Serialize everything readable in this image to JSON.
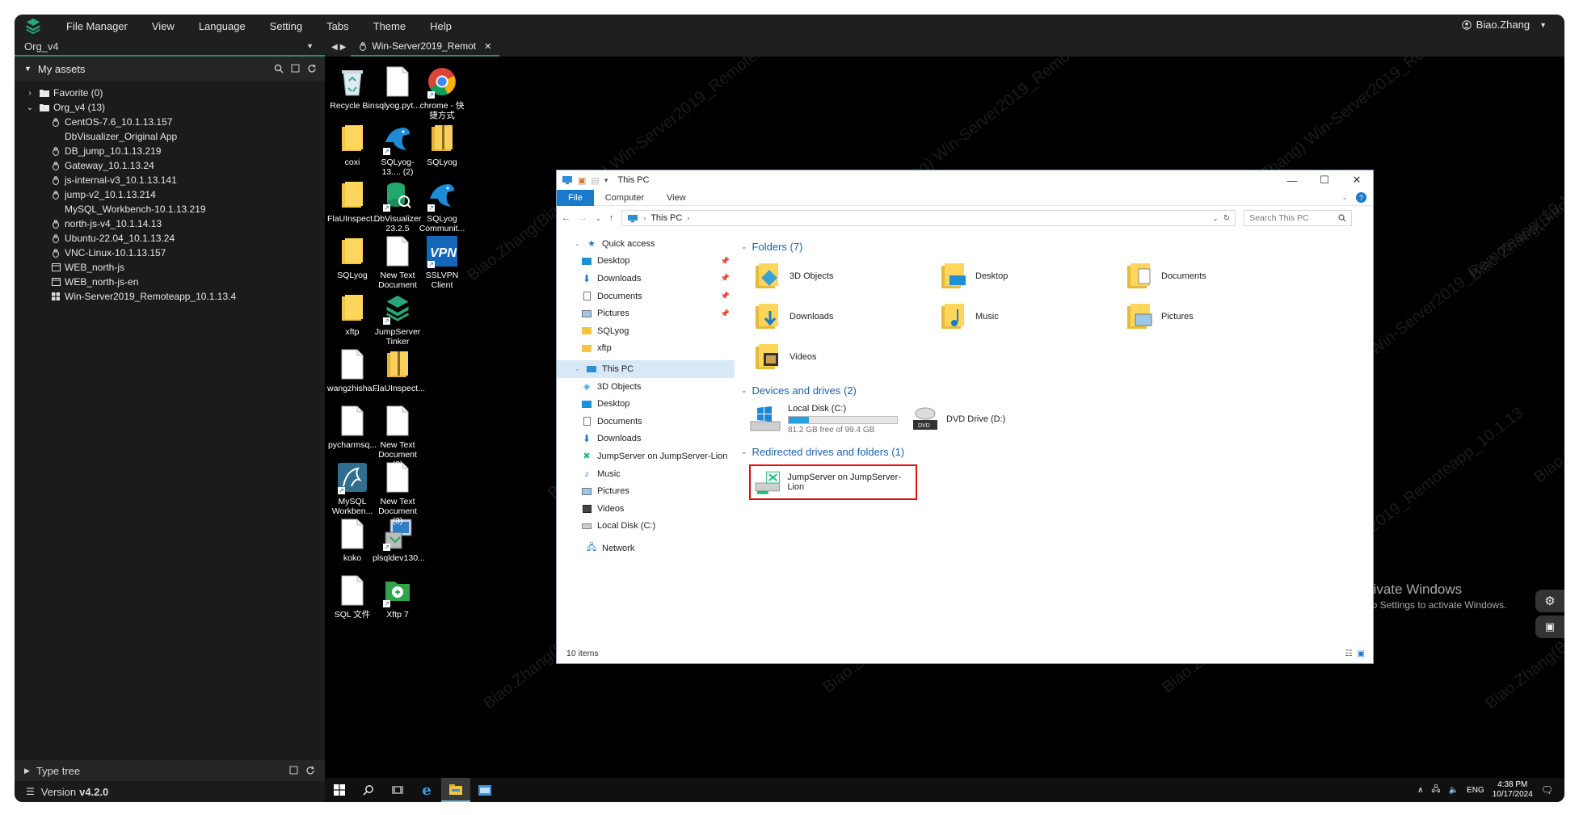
{
  "menubar": {
    "items": [
      "File Manager",
      "View",
      "Language",
      "Setting",
      "Tabs",
      "Theme",
      "Help"
    ],
    "user": "Biao.Zhang"
  },
  "sidebar": {
    "org": "Org_v4",
    "assets_title": "My assets",
    "tree": [
      {
        "label": "Favorite (0)",
        "type": "folder",
        "level": 0,
        "expanded": false
      },
      {
        "label": "Org_v4 (13)",
        "type": "folder",
        "level": 0,
        "expanded": true
      },
      {
        "label": "CentOS-7.6_10.1.13.157",
        "type": "linux",
        "level": 1
      },
      {
        "label": "DbVisualizer_Original App",
        "type": "none",
        "level": 1
      },
      {
        "label": "DB_jump_10.1.13.219",
        "type": "linux",
        "level": 1
      },
      {
        "label": "Gateway_10.1.13.24",
        "type": "linux",
        "level": 1
      },
      {
        "label": "js-internal-v3_10.1.13.141",
        "type": "linux",
        "level": 1
      },
      {
        "label": "jump-v2_10.1.13.214",
        "type": "linux",
        "level": 1
      },
      {
        "label": "MySQL_Workbench-10.1.13.219",
        "type": "none",
        "level": 1
      },
      {
        "label": "north-js-v4_10.1.14.13",
        "type": "linux",
        "level": 1
      },
      {
        "label": "Ubuntu-22.04_10.1.13.24",
        "type": "linux",
        "level": 1
      },
      {
        "label": "VNC-Linux-10.1.13.157",
        "type": "linux",
        "level": 1
      },
      {
        "label": "WEB_north-js",
        "type": "web",
        "level": 1
      },
      {
        "label": "WEB_north-js-en",
        "type": "web",
        "level": 1
      },
      {
        "label": "Win-Server2019_Remoteapp_10.1.13.4",
        "type": "windows",
        "level": 1
      }
    ],
    "type_tree": "Type tree",
    "version_label": "Version",
    "version": "v4.2.0"
  },
  "tab": {
    "label": "Win-Server2019_Remot"
  },
  "desktop": {
    "icons": [
      {
        "label": "Recycle Bin",
        "kind": "recycle-bin"
      },
      {
        "label": "sqlyog.pyt...",
        "kind": "file"
      },
      {
        "label": "chrome - 快捷方式",
        "kind": "chrome"
      },
      {
        "label": "coxi",
        "kind": "folder"
      },
      {
        "label": "SQLyog-13.... (2)",
        "kind": "dolphin"
      },
      {
        "label": "SQLyog",
        "kind": "zip"
      },
      {
        "label": "FlaUInspect...",
        "kind": "folder"
      },
      {
        "label": "DbVisualizer 23.2.5",
        "kind": "dbvis"
      },
      {
        "label": "SQLyog Communit...",
        "kind": "dolphin"
      },
      {
        "label": "SQLyog",
        "kind": "folder"
      },
      {
        "label": "New Text Document",
        "kind": "file"
      },
      {
        "label": "SSLVPN Client",
        "kind": "vpn"
      },
      {
        "label": "xftp",
        "kind": "folder"
      },
      {
        "label": "JumpServer Tinker",
        "kind": "jumpserver"
      },
      {
        "label": "wangzhisha...",
        "kind": "file"
      },
      {
        "label": "FlaUInspect...",
        "kind": "zip"
      },
      {
        "label": "pycharmsq...",
        "kind": "file"
      },
      {
        "label": "New Text Document (2)",
        "kind": "file"
      },
      {
        "label": "MySQL Workben...",
        "kind": "mysql"
      },
      {
        "label": "New Text Document (3)",
        "kind": "file"
      },
      {
        "label": "koko",
        "kind": "file"
      },
      {
        "label": "plsqldev130...",
        "kind": "installer"
      },
      {
        "label": "SQL 文件",
        "kind": "file"
      },
      {
        "label": "Xftp 7",
        "kind": "xftp"
      }
    ],
    "watermark": "Biao.Zhang(Biao.Zhang) Win-Server2019_Remoteapp_10.1.13"
  },
  "explorer": {
    "title": "This PC",
    "ribbon_tabs": [
      "File",
      "Computer",
      "View"
    ],
    "address": "This PC",
    "search_placeholder": "Search This PC",
    "nav": [
      {
        "label": "Quick access",
        "icon": "star",
        "top": true
      },
      {
        "label": "Desktop",
        "icon": "desktop",
        "pinned": true
      },
      {
        "label": "Downloads",
        "icon": "download",
        "pinned": true
      },
      {
        "label": "Documents",
        "icon": "document",
        "pinned": true
      },
      {
        "label": "Pictures",
        "icon": "picture",
        "pinned": true
      },
      {
        "label": "SQLyog",
        "icon": "folder"
      },
      {
        "label": "xftp",
        "icon": "folder"
      },
      {
        "label": "This PC",
        "icon": "pc",
        "top": true,
        "selected": true
      },
      {
        "label": "3D Objects",
        "icon": "cube"
      },
      {
        "label": "Desktop",
        "icon": "desktop"
      },
      {
        "label": "Documents",
        "icon": "document"
      },
      {
        "label": "Downloads",
        "icon": "download"
      },
      {
        "label": "JumpServer on JumpServer-Lion",
        "icon": "netdrive"
      },
      {
        "label": "Music",
        "icon": "music"
      },
      {
        "label": "Pictures",
        "icon": "picture"
      },
      {
        "label": "Videos",
        "icon": "video"
      },
      {
        "label": "Local Disk (C:)",
        "icon": "disk"
      },
      {
        "label": "Network",
        "icon": "network",
        "top": true
      }
    ],
    "folders_header": "Folders (7)",
    "folders": [
      "3D Objects",
      "Desktop",
      "Documents",
      "Downloads",
      "Music",
      "Pictures",
      "Videos"
    ],
    "drives_header": "Devices and drives (2)",
    "local_disk": {
      "name": "Local Disk (C:)",
      "free": "81.2 GB free of 99.4 GB",
      "used_fraction": 0.183
    },
    "dvd": {
      "name": "DVD Drive (D:)"
    },
    "redirected_header": "Redirected drives and folders (1)",
    "redirected": "JumpServer on JumpServer-Lion",
    "status": "10 items"
  },
  "activation": {
    "line1": "Activate Windows",
    "line2": "Go to Settings to activate Windows."
  },
  "taskbar": {
    "lang": "ENG",
    "time": "4:38 PM",
    "date": "10/17/2024"
  },
  "colors": {
    "accent": "#2f8f6d",
    "win_blue": "#1979ca",
    "highlight": "#e01010"
  }
}
